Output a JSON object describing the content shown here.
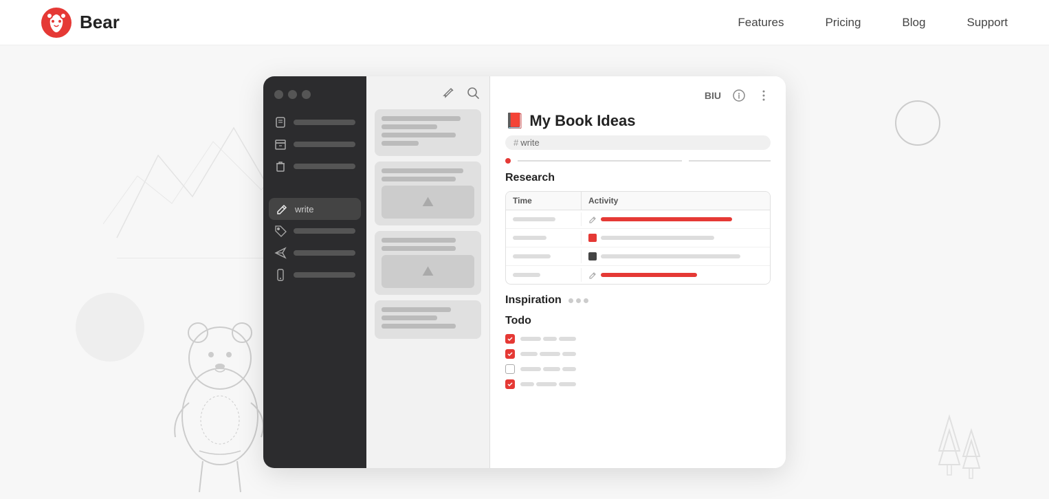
{
  "nav": {
    "logo_text": "Bear",
    "links": [
      "Features",
      "Pricing",
      "Blog",
      "Support"
    ]
  },
  "sidebar": {
    "items": [
      {
        "id": "notes",
        "label": "",
        "icon": "note"
      },
      {
        "id": "archive",
        "label": "",
        "icon": "archive"
      },
      {
        "id": "trash",
        "label": "",
        "icon": "trash"
      },
      {
        "id": "write",
        "label": "write",
        "icon": "pencil",
        "active": true
      },
      {
        "id": "tag1",
        "label": "",
        "icon": "tag"
      },
      {
        "id": "tag2",
        "label": "",
        "icon": "plane"
      },
      {
        "id": "tag3",
        "label": "",
        "icon": "phone"
      }
    ]
  },
  "editor": {
    "title": "My Book Ideas",
    "title_emoji": "📕",
    "tag": "write",
    "sections": {
      "research": "Research",
      "inspiration": "Inspiration",
      "todo": "Todo"
    },
    "table": {
      "col_time": "Time",
      "col_activity": "Activity",
      "rows": [
        {
          "time_width": 70,
          "act_icon": "pencil",
          "act_line_width": 80,
          "act_line_color": "red"
        },
        {
          "time_width": 50,
          "act_icon": "red-sq",
          "act_line_width": 65,
          "act_line_color": "normal"
        },
        {
          "time_width": 60,
          "act_icon": "dark-sq",
          "act_line_width": 85,
          "act_line_color": "normal"
        },
        {
          "time_width": 40,
          "act_icon": "pencil",
          "act_line_width": 60,
          "act_line_color": "red"
        }
      ]
    }
  },
  "toolbar": {
    "biu": "BIU",
    "info": "ℹ",
    "more": "⋮"
  }
}
